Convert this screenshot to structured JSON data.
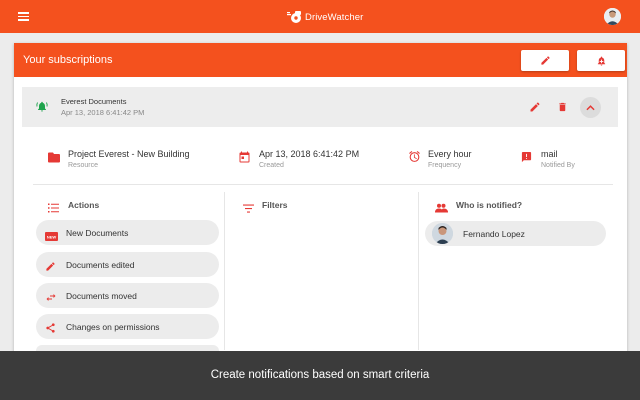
{
  "app": {
    "name": "DriveWatcher"
  },
  "colors": {
    "brand": "#f4511e",
    "bell": "#1ea34c",
    "accent_red": "#e53935"
  },
  "panel": {
    "title": "Your subscriptions"
  },
  "subscription": {
    "name": "Everest Documents",
    "date": "Apr 13, 2018 6:41:42 PM",
    "details": [
      {
        "value": "Project Everest - New Building",
        "label": "Resource",
        "icon": "folder-icon"
      },
      {
        "value": "Apr 13, 2018 6:41:42 PM",
        "label": "Created",
        "icon": "calendar-icon"
      },
      {
        "value": "Every hour",
        "label": "Frequency",
        "icon": "alarm-clock-icon"
      },
      {
        "value": "mail",
        "label": "Notified By",
        "icon": "alert-icon"
      }
    ]
  },
  "columns": {
    "actions": "Actions",
    "filters": "Filters",
    "notified": "Who is notified?"
  },
  "actions": [
    {
      "label": "New Documents",
      "icon": "new-badge-icon",
      "badge": "NEW"
    },
    {
      "label": "Documents edited",
      "icon": "pencil-icon"
    },
    {
      "label": "Documents moved",
      "icon": "swap-arrows-icon"
    },
    {
      "label": "Changes on permissions",
      "icon": "share-icon"
    }
  ],
  "people": [
    {
      "name": "Fernando Lopez"
    }
  ],
  "caption": "Create notifications based on smart criteria"
}
